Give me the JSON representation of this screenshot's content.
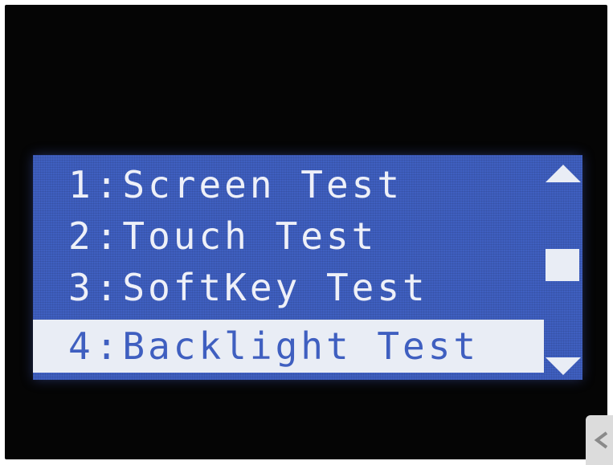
{
  "menu": {
    "items": [
      {
        "number": "1",
        "separator": ":",
        "label": "Screen Test",
        "selected": false
      },
      {
        "number": "2",
        "separator": ":",
        "label": "Touch Test",
        "selected": false
      },
      {
        "number": "3",
        "separator": ":",
        "label": "SoftKey Test",
        "selected": false
      },
      {
        "number": "4",
        "separator": ":",
        "label": "Backlight Test",
        "selected": true
      }
    ]
  },
  "scrollbar": {
    "up_icon": "triangle-up-icon",
    "down_icon": "triangle-down-icon",
    "thumb_position": 0.5
  },
  "colors": {
    "screen_background": "#3f5fc0",
    "text": "#eef0f8",
    "highlight": "#e9edf5",
    "bezel": "#050505"
  }
}
